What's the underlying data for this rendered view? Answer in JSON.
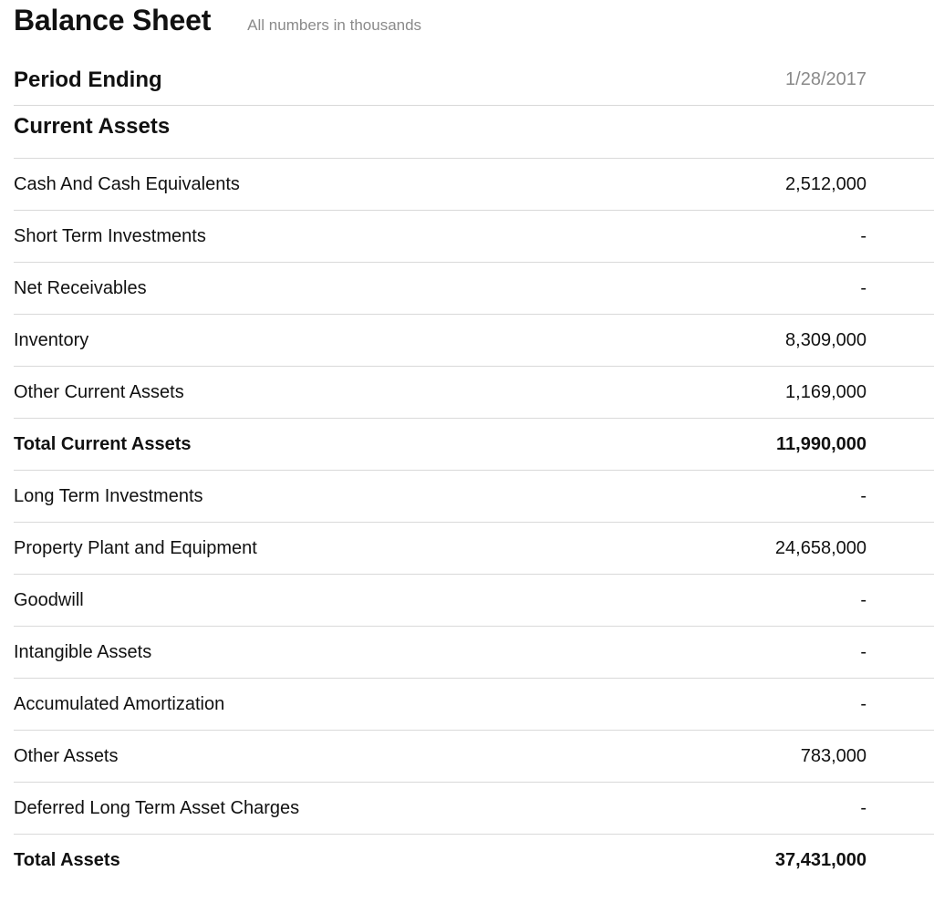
{
  "header": {
    "title": "Balance Sheet",
    "subtitle": "All numbers in thousands"
  },
  "table": {
    "period_label": "Period Ending",
    "period_value": "1/28/2017",
    "section_label": "Current Assets",
    "rows": [
      {
        "label": "Cash And Cash Equivalents",
        "value": "2,512,000"
      },
      {
        "label": "Short Term Investments",
        "value": "-"
      },
      {
        "label": "Net Receivables",
        "value": "-"
      },
      {
        "label": "Inventory",
        "value": "8,309,000"
      },
      {
        "label": "Other Current Assets",
        "value": "1,169,000"
      },
      {
        "label": "Total Current Assets",
        "value": "11,990,000"
      },
      {
        "label": "Long Term Investments",
        "value": "-"
      },
      {
        "label": "Property Plant and Equipment",
        "value": "24,658,000"
      },
      {
        "label": "Goodwill",
        "value": "-"
      },
      {
        "label": "Intangible Assets",
        "value": "-"
      },
      {
        "label": "Accumulated Amortization",
        "value": "-"
      },
      {
        "label": "Other Assets",
        "value": "783,000"
      },
      {
        "label": "Deferred Long Term Asset Charges",
        "value": "-"
      },
      {
        "label": "Total Assets",
        "value": "37,431,000"
      }
    ]
  }
}
